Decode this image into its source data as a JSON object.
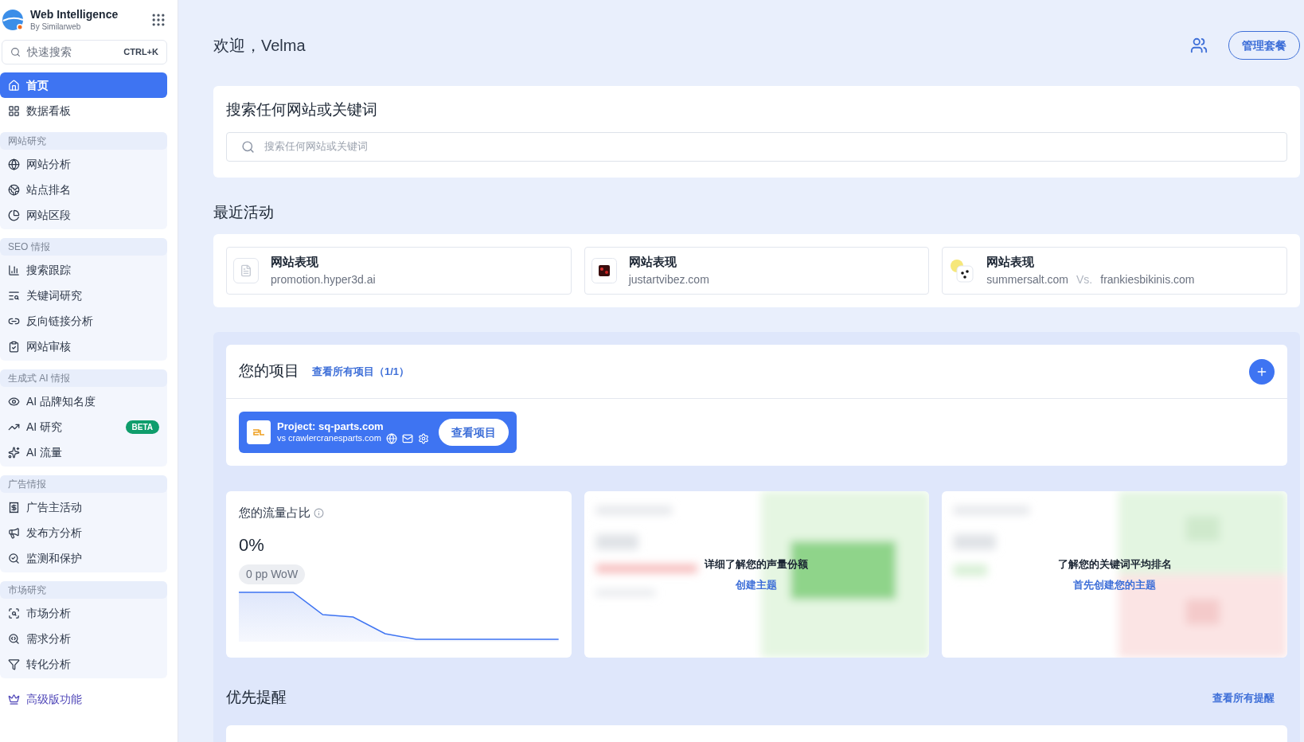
{
  "brand": {
    "name": "Web Intelligence",
    "byline": "By Similarweb"
  },
  "quick_search": {
    "placeholder": "快速搜索",
    "shortcut": "CTRL+K"
  },
  "nav_top": [
    {
      "label": "首页",
      "selected": true
    },
    {
      "label": "数据看板",
      "selected": false
    }
  ],
  "nav_groups": [
    {
      "title": "网站研究",
      "items": [
        {
          "label": "网站分析",
          "selected": false
        },
        {
          "label": "站点排名",
          "selected": false
        },
        {
          "label": "网站区段",
          "selected": false
        }
      ]
    },
    {
      "title": "SEO 情报",
      "items": [
        {
          "label": "搜索跟踪",
          "selected": false
        },
        {
          "label": "关键词研究",
          "selected": false
        },
        {
          "label": "反向链接分析",
          "selected": false
        },
        {
          "label": "网站审核",
          "selected": false
        }
      ]
    },
    {
      "title": "生成式 AI 情报",
      "items": [
        {
          "label": "AI 品牌知名度",
          "selected": false
        },
        {
          "label": "AI 研究",
          "selected": false,
          "badge": "BETA"
        },
        {
          "label": "AI 流量",
          "selected": false
        }
      ]
    },
    {
      "title": "广告情报",
      "items": [
        {
          "label": "广告主活动",
          "selected": false
        },
        {
          "label": "发布方分析",
          "selected": false
        },
        {
          "label": "监测和保护",
          "selected": false
        }
      ]
    },
    {
      "title": "市场研究",
      "items": [
        {
          "label": "市场分析",
          "selected": false
        },
        {
          "label": "需求分析",
          "selected": false
        },
        {
          "label": "转化分析",
          "selected": false
        }
      ]
    }
  ],
  "premium": {
    "label": "高级版功能"
  },
  "greeting": "欢迎，Velma",
  "manage_button": "管理套餐",
  "search_card": {
    "title": "搜索任何网站或关键词",
    "placeholder": "搜索任何网站或关键词"
  },
  "recent": {
    "title": "最近活动",
    "items": [
      {
        "kind": "single",
        "title": "网站表现",
        "site": "promotion.hyper3d.ai"
      },
      {
        "kind": "single",
        "title": "网站表现",
        "site": "justartvibez.com"
      },
      {
        "kind": "compare",
        "title": "网站表现",
        "site": "summersalt.com",
        "vs": "Vs.",
        "site_2": "frankiesbikinis.com"
      }
    ]
  },
  "projects": {
    "title": "您的项目",
    "link": "查看所有项目（1/1）",
    "project": {
      "name": "Project: sq-parts.com",
      "competitor": "vs crawlercranesparts.com",
      "button": "查看项目"
    }
  },
  "metrics": [
    {
      "kind": "metric",
      "title": "您的流量占比",
      "value": "0%",
      "badge": "0 pp WoW"
    },
    {
      "kind": "locked",
      "message": "详细了解您的声量份额",
      "link": "创建主题"
    },
    {
      "kind": "locked",
      "message": "了解您的关键词平均排名",
      "link": "首先创建您的主题"
    }
  ],
  "alerts": {
    "title": "优先提醒",
    "link": "查看所有提醒"
  }
}
